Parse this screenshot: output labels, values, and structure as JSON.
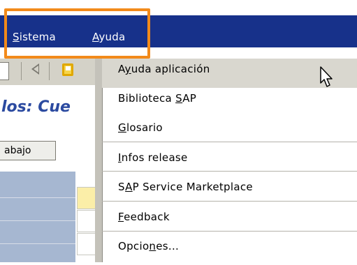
{
  "menubar": {
    "items": [
      {
        "pre": "",
        "mnemonic": "S",
        "rest": "istema"
      },
      {
        "pre": "",
        "mnemonic": "A",
        "rest": "yuda"
      }
    ]
  },
  "title": {
    "text": "los: Cue"
  },
  "work_button": {
    "label": "abajo"
  },
  "dropdown": {
    "items": [
      {
        "pre": "A",
        "mnemonic": "y",
        "rest": "uda aplicación"
      },
      {
        "pre": "Biblioteca ",
        "mnemonic": "S",
        "rest": "AP"
      },
      {
        "pre": "",
        "mnemonic": "G",
        "rest": "losario"
      },
      {
        "pre": "",
        "mnemonic": "I",
        "rest": "nfos release"
      },
      {
        "pre": "S",
        "mnemonic": "A",
        "rest": "P Service Marketplace"
      },
      {
        "pre": "",
        "mnemonic": "F",
        "rest": "eedback"
      },
      {
        "pre": "Opcio",
        "mnemonic": "n",
        "rest": "es..."
      }
    ]
  },
  "colors": {
    "menubar": "#17318a",
    "highlight": "#f28a1a",
    "menu_hover": "#d9d7cf",
    "title": "#2b4aa0",
    "grid_blue": "#a6b7d1"
  },
  "icons": {
    "back": "back-triangle-icon",
    "save": "save-icon",
    "cursor": "mouse-pointer-icon"
  }
}
